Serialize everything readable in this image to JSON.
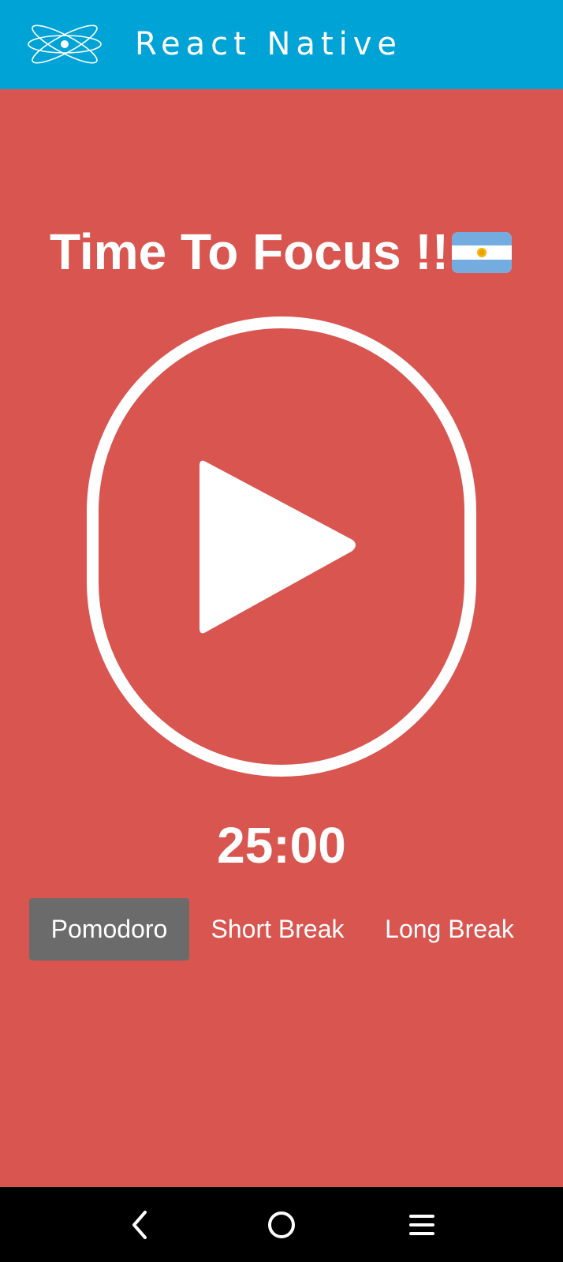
{
  "header": {
    "title": "React Native",
    "logo_icon": "react-atom-icon",
    "background_color": "#00a3d6"
  },
  "screen": {
    "heading": "Time To Focus !!",
    "flag_icon": "argentina-flag-icon",
    "background_color": "#d95550",
    "play_icon": "play-icon",
    "timer": "25:00"
  },
  "tabs": [
    {
      "label": "Pomodoro",
      "active": true
    },
    {
      "label": "Short Break",
      "active": false
    },
    {
      "label": "Long Break",
      "active": false
    }
  ],
  "navbar": {
    "back_icon": "back-chevron-icon",
    "home_icon": "home-circle-icon",
    "menu_icon": "menu-lines-icon"
  }
}
